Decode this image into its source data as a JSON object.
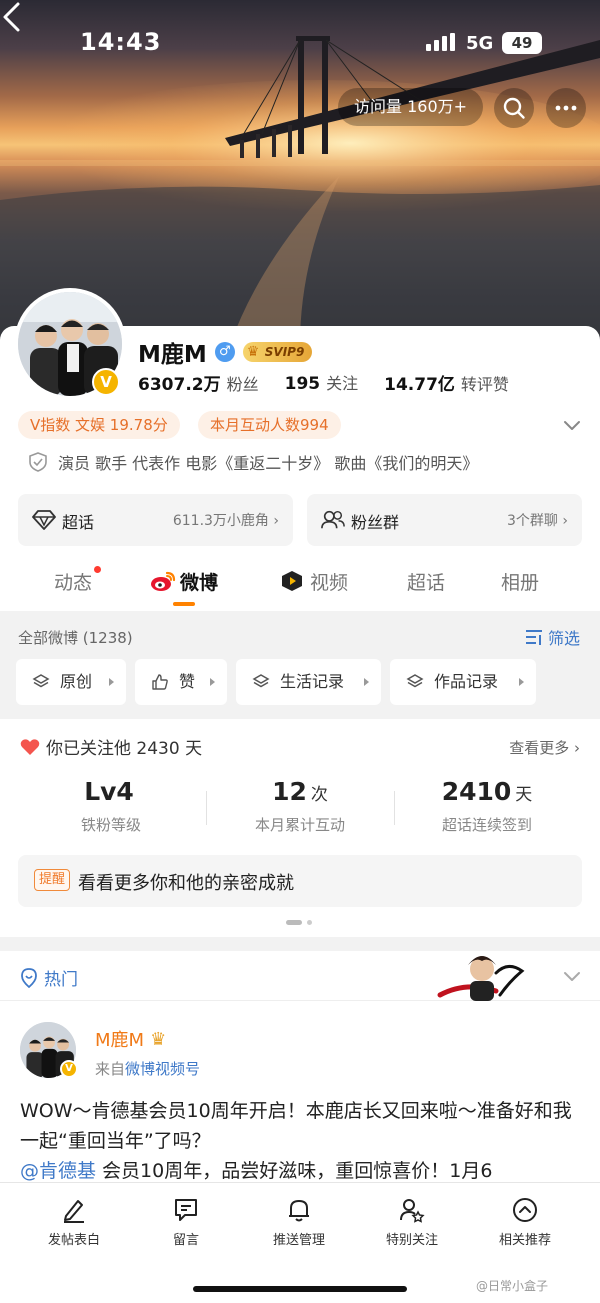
{
  "status_bar": {
    "time": "14:43",
    "network": "5G",
    "battery": "49"
  },
  "header": {
    "visits": "访问量 160万+"
  },
  "profile": {
    "name": "M鹿M",
    "vip_level": "SVIP9",
    "verified_badge": "V",
    "stats": [
      {
        "value": "6307.2万",
        "label": "粉丝"
      },
      {
        "value": "195",
        "label": "关注"
      },
      {
        "value": "14.77亿",
        "label": "转评赞"
      }
    ],
    "tags": [
      "V指数 文娱 19.78分",
      "本月互动人数994"
    ],
    "bio": "演员 歌手 代表作 电影《重返二十岁》 歌曲《我们的明天》",
    "cards": [
      {
        "label": "超话",
        "sub": "611.3万小鹿角"
      },
      {
        "label": "粉丝群",
        "sub": "3个群聊"
      }
    ]
  },
  "tabs": [
    "动态",
    "微博",
    "视频",
    "超话",
    "相册"
  ],
  "feed_filter": {
    "count": "全部微博 (1238)",
    "filter_label": "筛选",
    "chips": [
      "原创",
      "赞",
      "生活记录",
      "作品记录"
    ]
  },
  "fan_card": {
    "follow_text": "你已关注他 2430 天",
    "more": "查看更多",
    "metrics": [
      {
        "value": "Lv4",
        "unit": "",
        "label": "铁粉等级"
      },
      {
        "value": "12",
        "unit": "次",
        "label": "本月累计互动"
      },
      {
        "value": "2410",
        "unit": "天",
        "label": "超话连续签到"
      }
    ],
    "tip_badge": "提醒",
    "tip_text": "看看更多你和他的亲密成就"
  },
  "hot": {
    "label": "热门"
  },
  "post": {
    "author": "M鹿M",
    "source_prefix": "来自",
    "source": "微博视频号",
    "text_line1": "WOW～肯德基会员10周年开启！本鹿店长又回来啦～准备好和我一起“重回当年”了吗？",
    "mention": "@肯德基",
    "text_line2": " 会员10周年，品尝好滋味，重回惊喜价！1月6"
  },
  "bottom_bar": [
    "发帖表白",
    "留言",
    "推送管理",
    "特别关注",
    "相关推荐"
  ],
  "watermark": "@日常小盒子",
  "colors": {
    "accent_orange": "#ff8200",
    "link_blue": "#3f79c8",
    "tag_bg": "#fdf0e6"
  }
}
